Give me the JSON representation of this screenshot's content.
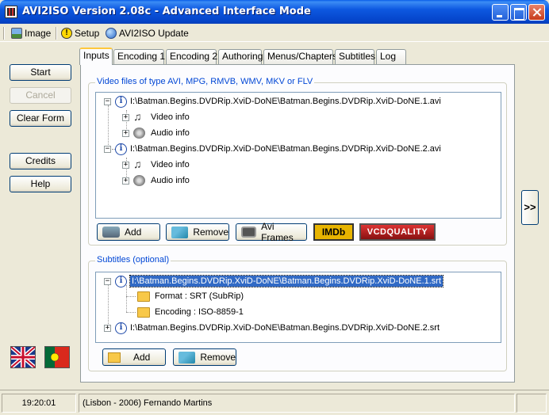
{
  "window": {
    "title": "AVI2ISO Version 2.08c - Advanced Interface Mode"
  },
  "menu": {
    "image": "Image",
    "setup": "Setup",
    "update": "AVI2ISO Update"
  },
  "left_buttons": {
    "start": "Start",
    "cancel": "Cancel",
    "clear": "Clear Form",
    "credits": "Credits",
    "help": "Help"
  },
  "tabs": [
    "Inputs",
    "Encoding 1",
    "Encoding 2",
    "Authoring",
    "Menus/Chapters",
    "Subtitles",
    "Log"
  ],
  "video_group": {
    "label": "Video files of type AVI, MPG, RMVB, WMV, MKV or FLV",
    "files": [
      {
        "path": "I:\\Batman.Begins.DVDRip.XviD-DoNE\\Batman.Begins.DVDRip.XviD-DoNE.1.avi",
        "video": "Video info",
        "audio": "Audio info"
      },
      {
        "path": "I:\\Batman.Begins.DVDRip.XviD-DoNE\\Batman.Begins.DVDRip.XviD-DoNE.2.avi",
        "video": "Video info",
        "audio": "Audio info"
      }
    ],
    "buttons": {
      "add": "Add",
      "remove": "Remove",
      "frames": "Avi Frames",
      "imdb": "IMDb",
      "vcdq": "VCDQUALITY"
    }
  },
  "subs_group": {
    "label": "Subtitles (optional)",
    "files": [
      {
        "path": "I:\\Batman.Begins.DVDRip.XviD-DoNE\\Batman.Begins.DVDRip.XviD-DoNE.1.srt",
        "format": "Format : SRT (SubRip)",
        "encoding": "Encoding : ISO-8859-1"
      },
      {
        "path": "I:\\Batman.Begins.DVDRip.XviD-DoNE\\Batman.Begins.DVDRip.XviD-DoNE.2.srt"
      }
    ],
    "buttons": {
      "add": "Add",
      "remove": "Remove"
    }
  },
  "next_button": ">>",
  "status": {
    "time": "19:20:01",
    "credit": "(Lisbon - 2006) Fernando Martins"
  },
  "colors": {
    "title_bar": "#0a5ee8",
    "selection": "#316ac5",
    "group_label": "#0046d5"
  }
}
